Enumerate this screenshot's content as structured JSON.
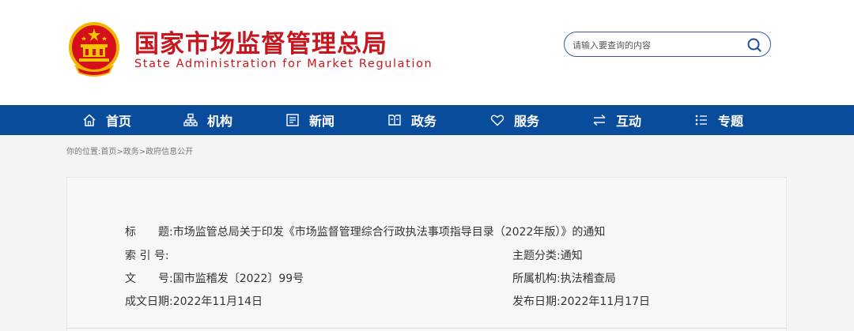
{
  "header": {
    "title": "国家市场监督管理总局",
    "subtitle": "State Administration for Market Regulation",
    "search_placeholder": "请输入要查询的内容"
  },
  "nav": {
    "items": [
      {
        "label": "首页",
        "icon": "home-icon"
      },
      {
        "label": "机构",
        "icon": "org-chart-icon"
      },
      {
        "label": "新闻",
        "icon": "news-icon"
      },
      {
        "label": "政务",
        "icon": "government-affairs-icon"
      },
      {
        "label": "服务",
        "icon": "heart-icon"
      },
      {
        "label": "互动",
        "icon": "exchange-icon"
      },
      {
        "label": "专题",
        "icon": "list-icon"
      }
    ]
  },
  "breadcrumb": {
    "prefix": "你的位置:",
    "items": [
      "首页",
      "政务",
      "政府信息公开"
    ],
    "separator": ">"
  },
  "info": {
    "title_label": "标　　题:",
    "title_value": "市场监管总局关于印发《市场监督管理综合行政执法事项指导目录（2022年版）》的通知",
    "index_label": "索 引 号:",
    "index_value": "",
    "category_label": "主题分类:",
    "category_value": "通知",
    "docno_label": "文　　号:",
    "docno_value": "国市监稽发〔2022〕99号",
    "org_label": "所属机构:",
    "org_value": "执法稽查局",
    "date_label": "成文日期:",
    "date_value": "2022年11月14日",
    "pub_label": "发布日期:",
    "pub_value": "2022年11月17日"
  },
  "colors": {
    "brand_red": "#c8161e",
    "nav_blue": "#0a4c9c",
    "search_border": "#2a5aa8"
  }
}
